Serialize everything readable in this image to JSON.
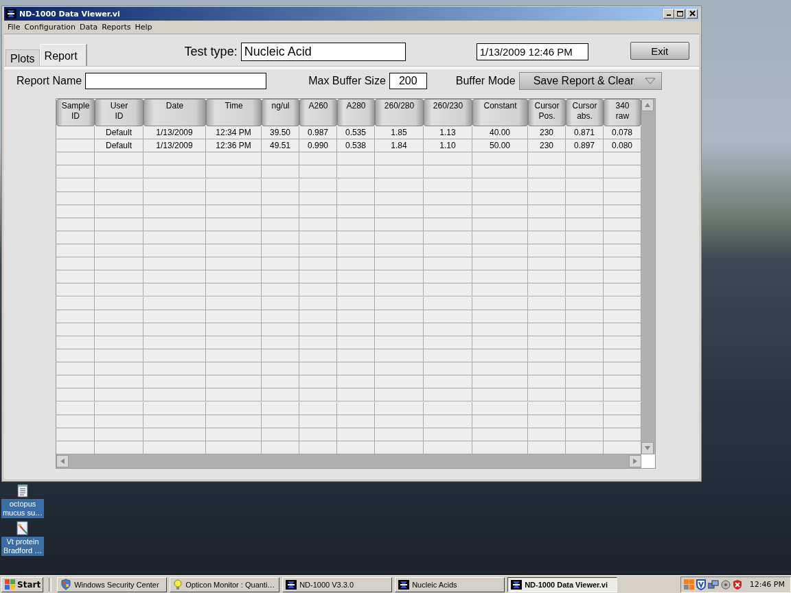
{
  "window": {
    "title": "ND-1000 Data Viewer.vi",
    "menu": [
      "File",
      "Configuration",
      "Data",
      "Reports",
      "Help"
    ],
    "tabs": [
      {
        "label": "Plots",
        "selected": false
      },
      {
        "label": "Report",
        "selected": true
      }
    ],
    "test_type": {
      "label": "Test type:",
      "value": "Nucleic Acid"
    },
    "datetime": "1/13/2009  12:46 PM",
    "exit_button": "Exit",
    "report_name": {
      "label": "Report Name"
    },
    "max_buffer_size": {
      "label": "Max Buffer Size",
      "value": "200"
    },
    "buffer_mode": {
      "label": "Buffer Mode",
      "value": "Save Report & Clear"
    },
    "table": {
      "columns": [
        "Sample ID",
        "User ID",
        "Date",
        "Time",
        "ng/ul",
        "A260",
        "A280",
        "260/280",
        "260/230",
        "Constant",
        "Cursor Pos.",
        "Cursor abs.",
        "340 raw"
      ],
      "rows": [
        [
          null,
          "Default",
          "1/13/2009",
          "12:34 PM",
          "39.50",
          "0.987",
          "0.535",
          "1.85",
          "1.13",
          "40.00",
          "230",
          "0.871",
          "0.078"
        ],
        [
          null,
          "Default",
          "1/13/2009",
          "12:36 PM",
          "49.51",
          "0.990",
          "0.538",
          "1.84",
          "1.10",
          "50.00",
          "230",
          "0.897",
          "0.080"
        ]
      ]
    }
  },
  "desktop_icons": [
    {
      "label": "octopus mucus su…",
      "kind": "text"
    },
    {
      "label": "Vt protein Bradford …",
      "kind": "image"
    }
  ],
  "taskbar": {
    "start": "Start",
    "items": [
      {
        "label": "Windows Security Center",
        "kind": "shield",
        "selected": false
      },
      {
        "label": "Opticon Monitor : Quanti…",
        "kind": "bulb",
        "selected": false
      },
      {
        "label": "ND-1000 V3.3.0",
        "kind": "nd",
        "selected": false
      },
      {
        "label": "Nucleic Acids",
        "kind": "nd",
        "selected": false
      },
      {
        "label": "ND-1000 Data Viewer.vi",
        "kind": "nd",
        "selected": true
      }
    ],
    "clock": "12:46 PM"
  }
}
